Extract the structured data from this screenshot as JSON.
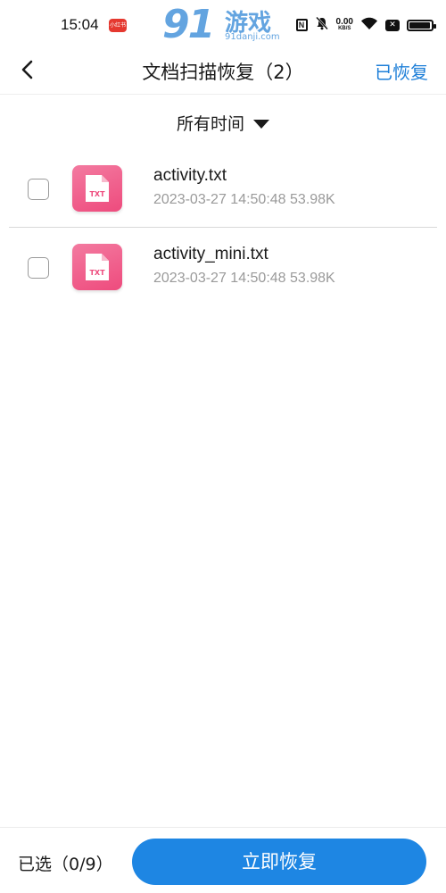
{
  "status_bar": {
    "time": "15:04",
    "app_badge": "小红书",
    "network_speed": "0.00",
    "network_speed_unit": "KB/S",
    "nfc": "N",
    "sim": "✕",
    "battery_level": 0.95
  },
  "watermark": {
    "big": "91",
    "cn": "游戏",
    "url": "91danji.com"
  },
  "header": {
    "title": "文档扫描恢复（2）",
    "recovered_link": "已恢复"
  },
  "filter": {
    "label": "所有时间"
  },
  "files": [
    {
      "name": "activity.txt",
      "meta": "2023-03-27 14:50:48 53.98K",
      "icon_label": "TXT",
      "checked": false
    },
    {
      "name": "activity_mini.txt",
      "meta": "2023-03-27 14:50:48 53.98K",
      "icon_label": "TXT",
      "checked": false
    }
  ],
  "bottom_bar": {
    "selected_count": "已选（0/9）",
    "recover_button": "立即恢复"
  },
  "colors": {
    "accent": "#1e86e3",
    "file_icon": "#ee4b7d"
  }
}
